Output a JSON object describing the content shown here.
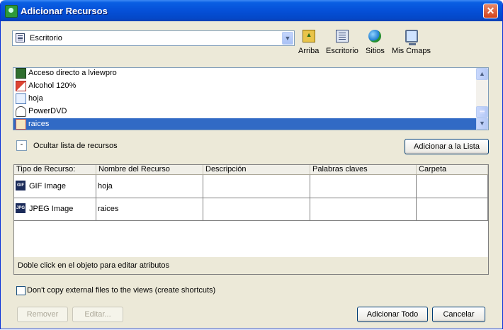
{
  "window": {
    "title": "Adicionar Recursos"
  },
  "location": {
    "current": "Escritorio"
  },
  "toolbar": [
    {
      "name": "up",
      "label": "Arriba",
      "icon": "folder-up-icon"
    },
    {
      "name": "desktop",
      "label": "Escritorio",
      "icon": "desktop-icon"
    },
    {
      "name": "sites",
      "label": "Sitios",
      "icon": "globe-icon"
    },
    {
      "name": "mycmaps",
      "label": "Mis Cmaps",
      "icon": "computer-icon"
    }
  ],
  "files": [
    {
      "label": "Acceso directo a lviewpro",
      "icon": "shortcut-icon"
    },
    {
      "label": "Alcohol 120%",
      "icon": "alcohol-icon"
    },
    {
      "label": "hoja",
      "icon": "image-file-icon"
    },
    {
      "label": "PowerDVD",
      "icon": "dvd-icon"
    },
    {
      "label": "raices",
      "icon": "image-file-icon",
      "selected": true
    }
  ],
  "toggle": {
    "symbol": "-",
    "label": "Ocultar lista de recursos"
  },
  "add_to_list_label": "Adicionar a la Lista",
  "table": {
    "headers": [
      "Tipo de Recurso:",
      "Nombre del Recurso",
      "Descripción",
      "Palabras claves",
      "Carpeta"
    ],
    "rows": [
      {
        "type": "GIF Image",
        "type_badge": "GIF",
        "name": "hoja",
        "description": "",
        "keywords": "",
        "folder": ""
      },
      {
        "type": "JPEG Image",
        "type_badge": "JPG",
        "name": "raices",
        "description": "",
        "keywords": "",
        "folder": ""
      }
    ],
    "status": "Doble click en el objeto para editar atributos"
  },
  "checkbox": {
    "label": "Don't copy external files to the views (create shortcuts)",
    "checked": false
  },
  "buttons": {
    "remove": "Remover",
    "edit": "Editar...",
    "add_all": "Adicionar Todo",
    "cancel": "Cancelar"
  }
}
